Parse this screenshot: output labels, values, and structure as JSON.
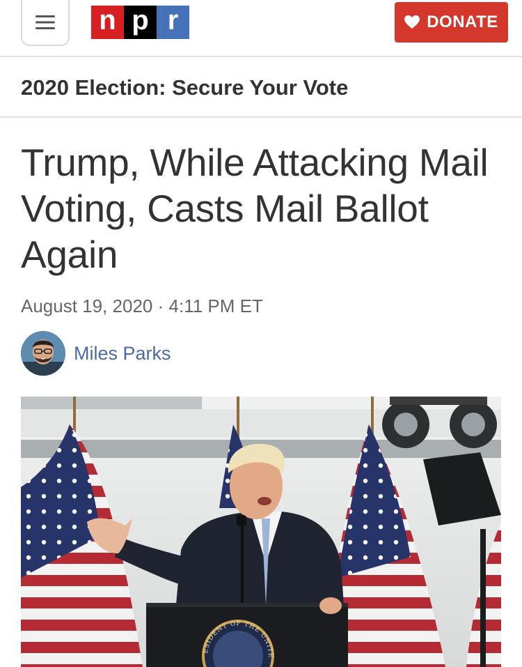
{
  "header": {
    "menu_icon": "hamburger-menu-icon",
    "logo_letters": [
      "n",
      "p",
      "r"
    ],
    "donate_label": "DONATE",
    "donate_icon": "heart-icon",
    "colors": {
      "logo_n": "#d62021",
      "logo_p": "#000000",
      "logo_r": "#4471b8",
      "donate_bg": "#d4382c"
    }
  },
  "section": {
    "title": "2020 Election: Secure Your Vote"
  },
  "article": {
    "headline": "Trump, While Attacking Mail Voting, Casts Mail Ballot Again",
    "date": "August 19, 2020",
    "separator": "·",
    "time": "4:11 PM ET",
    "author": "Miles Parks",
    "author_color": "#4a6aa5",
    "image_seal_text": "PRESIDENT OF THE UNITED"
  }
}
